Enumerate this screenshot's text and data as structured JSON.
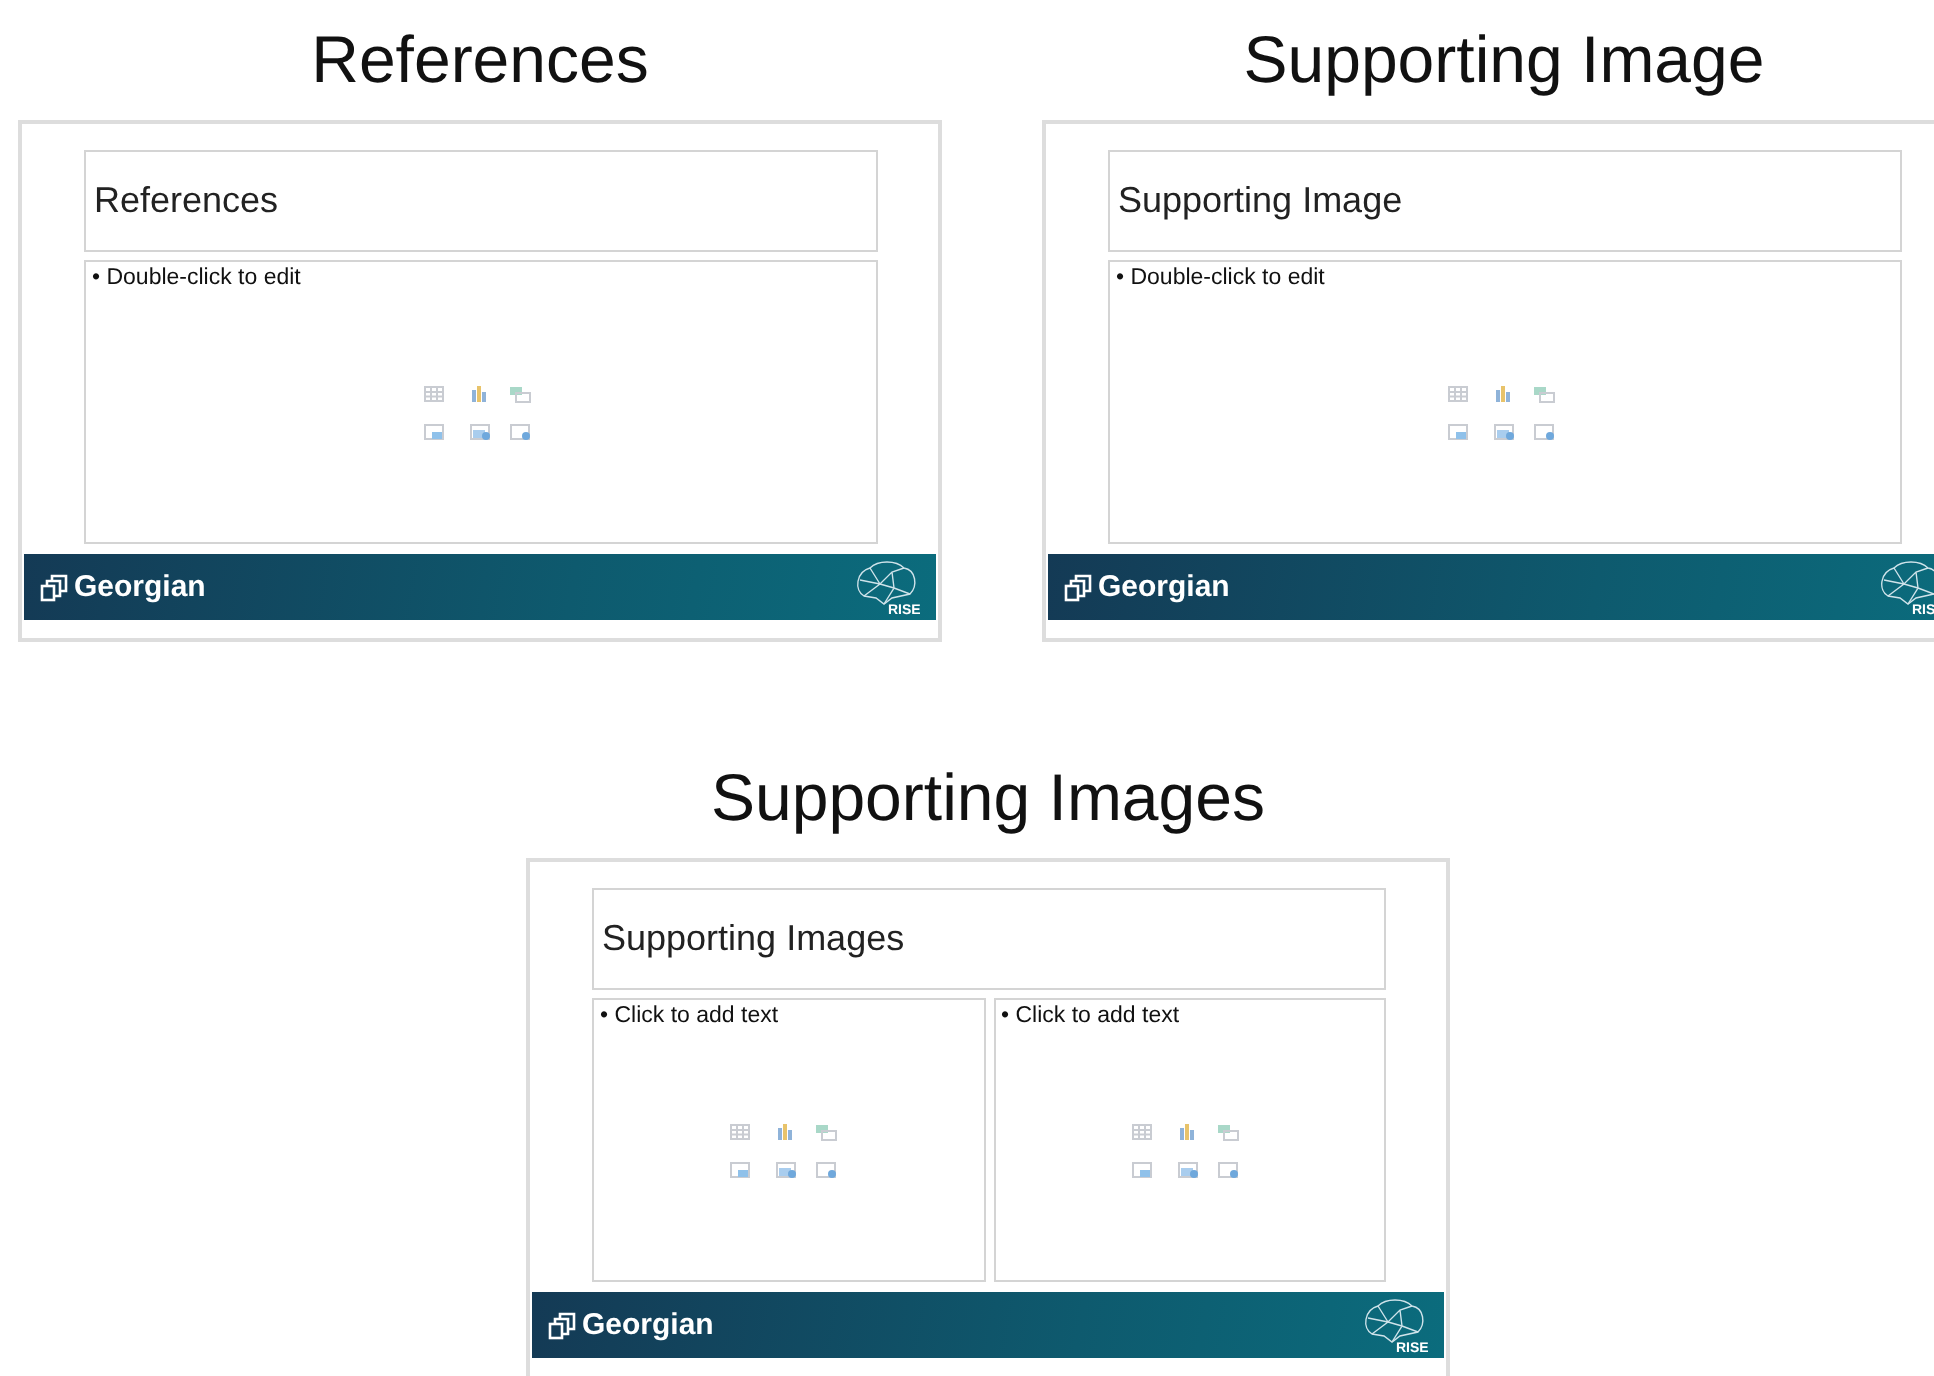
{
  "slides": [
    {
      "heading": "References",
      "title": "References",
      "placeholders": [
        {
          "text": "• Double-click to edit"
        }
      ],
      "brand": "Georgian",
      "badge": "RISE"
    },
    {
      "heading": "Supporting Image",
      "title": "Supporting Image",
      "placeholders": [
        {
          "text": "• Double-click to edit"
        }
      ],
      "brand": "Georgian",
      "badge": "RIS"
    },
    {
      "heading": "Supporting Images",
      "title": "Supporting Images",
      "placeholders": [
        {
          "text": "• Click to add text"
        },
        {
          "text": "• Click to add text"
        }
      ],
      "brand": "Georgian",
      "badge": "RISE"
    }
  ]
}
